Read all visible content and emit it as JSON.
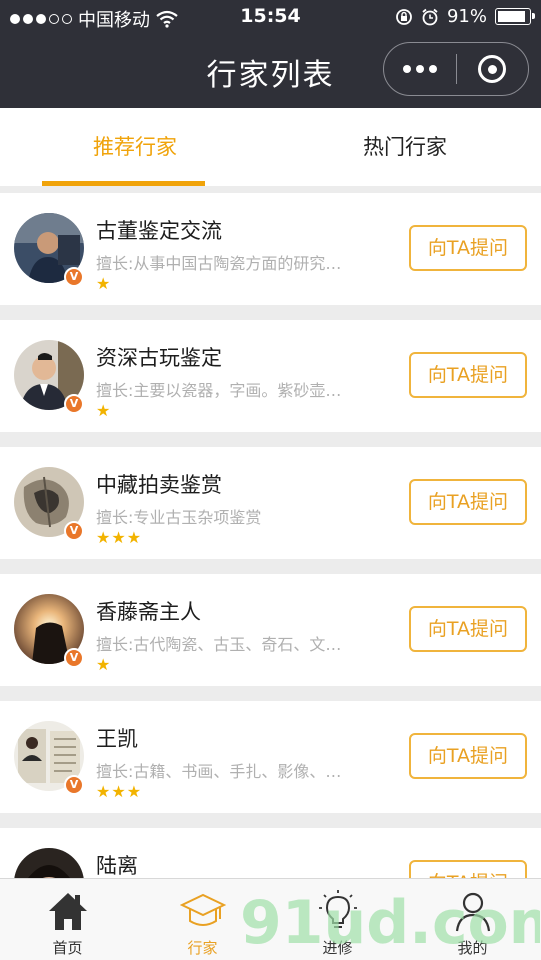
{
  "status_bar": {
    "carrier": "中国移动",
    "time": "15:54",
    "battery": "91%",
    "battery_level": 0.91
  },
  "nav": {
    "title": "行家列表",
    "more_icon": "more-dots-icon",
    "close_icon": "capsule-close-icon"
  },
  "tabs": [
    {
      "label": "推荐行家",
      "active": true
    },
    {
      "label": "热门行家",
      "active": false
    }
  ],
  "experts": [
    {
      "name": "古董鉴定交流",
      "specialty": "擅长:从事中国古陶瓷方面的研究…",
      "stars": "★",
      "rating": 1,
      "button": "向TA提问",
      "badge": "V"
    },
    {
      "name": "资深古玩鉴定",
      "specialty": "擅长:主要以瓷器，字画。紫砂壶…",
      "stars": "★",
      "rating": 1,
      "button": "向TA提问",
      "badge": "V"
    },
    {
      "name": "中藏拍卖鉴赏",
      "specialty": "擅长:专业古玉杂项鉴赏",
      "stars": "★★★",
      "rating": 3,
      "button": "向TA提问",
      "badge": "V"
    },
    {
      "name": "香藤斋主人",
      "specialty": "擅长:古代陶瓷、古玉、奇石、文…",
      "stars": "★",
      "rating": 1,
      "button": "向TA提问",
      "badge": "V"
    },
    {
      "name": "王凯",
      "specialty": "擅长:古籍、书画、手扎、影像、…",
      "stars": "★★★",
      "rating": 3,
      "button": "向TA提问",
      "badge": "V"
    },
    {
      "name": "陆离",
      "specialty": "",
      "stars": "",
      "rating": 0,
      "button": "向TA提问",
      "badge": ""
    }
  ],
  "tabbar": [
    {
      "label": "首页",
      "icon": "home-icon",
      "active": false
    },
    {
      "label": "行家",
      "icon": "graduation-cap-icon",
      "active": true
    },
    {
      "label": "进修",
      "icon": "lightbulb-icon",
      "active": false
    },
    {
      "label": "我的",
      "icon": "user-icon",
      "active": false
    }
  ],
  "watermark": "91ud.com",
  "colors": {
    "accent": "#f0a30a",
    "header_bg": "#2f3038",
    "badge": "#e9772a",
    "star": "#f2b300"
  }
}
